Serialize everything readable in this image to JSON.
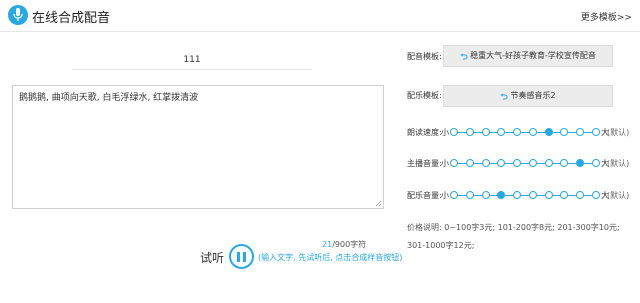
{
  "header": {
    "title": "在线合成配音",
    "more_link": "更多模板>>"
  },
  "editor": {
    "title_value": "111",
    "text_value": "鹅鹅鹅, 曲项向天歌, 白毛浮绿水, 红掌拨清波",
    "char_count": "21",
    "char_limit": "/900字符"
  },
  "playback": {
    "label": "试听",
    "hint": "(输入文字, 先试听后, 点击合成样音按钮)"
  },
  "side": {
    "voice_template_label": "配音模板:",
    "voice_template_value": "稳重大气-好孩子教育-学校宣传配音",
    "music_label": "配乐模板:",
    "music_value": "节奏感音乐2",
    "sliders": [
      {
        "label": "朗读速度:",
        "low": "小",
        "high": "大",
        "default": "(默认)",
        "steps": 10,
        "value_index": 6
      },
      {
        "label": "主播音量:",
        "low": "小",
        "high": "大",
        "default": "(默认)",
        "steps": 10,
        "value_index": 8
      },
      {
        "label": "配乐音量:",
        "low": "小",
        "high": "大",
        "default": "(默认)",
        "steps": 10,
        "value_index": 3
      }
    ],
    "price_text": "价格说明: 0~100字3元; 101-200字8元; 201-300字10元; 301-1000字12元;"
  },
  "colors": {
    "accent": "#29a9e0",
    "box_bg": "#ececec"
  }
}
